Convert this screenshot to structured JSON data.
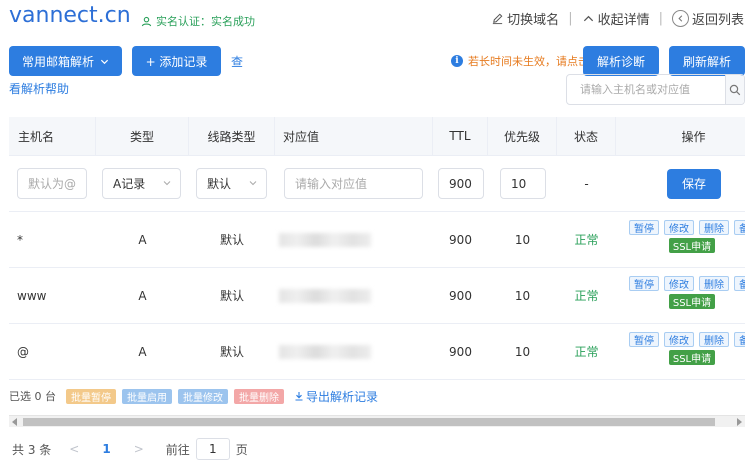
{
  "header": {
    "domain": "vannect.cn",
    "verify_text": "实名认证：实名成功",
    "switch_label": "切换域名",
    "collapse_label": "收起详情",
    "back_label": "返回列表"
  },
  "toolbar": {
    "mail_resolve_label": "常用邮箱解析",
    "add_record_label": "+ 添加记录",
    "lookup_part1": "查",
    "lookup_part2": "看解析帮助",
    "notice": "若长时间未生效，请点击:",
    "diagnose_label": "解析诊断",
    "refresh_label": "刷新解析",
    "search_placeholder": "请输入主机名或对应值"
  },
  "table": {
    "headers": [
      "主机名",
      "类型",
      "线路类型",
      "对应值",
      "TTL",
      "优先级",
      "状态",
      "操作"
    ],
    "edit_row": {
      "host_placeholder": "默认为@",
      "type_value": "A记录",
      "line_value": "默认",
      "value_placeholder": "请输入对应值",
      "ttl_value": "900",
      "priority_value": "10",
      "status": "-",
      "save_label": "保存"
    },
    "rows": [
      {
        "host": "*",
        "type": "A",
        "line": "默认",
        "ttl": "900",
        "priority": "10",
        "status": "正常"
      },
      {
        "host": "www",
        "type": "A",
        "line": "默认",
        "ttl": "900",
        "priority": "10",
        "status": "正常"
      },
      {
        "host": "@",
        "type": "A",
        "line": "默认",
        "ttl": "900",
        "priority": "10",
        "status": "正常"
      }
    ],
    "row_actions": {
      "pause": "暂停",
      "edit": "修改",
      "delete": "删除",
      "note": "备注",
      "ssl": "SSL申请"
    }
  },
  "batch": {
    "selected": "已选 0 台",
    "pause": "批量暂停",
    "enable": "批量启用",
    "edit": "批量修改",
    "delete": "批量删除",
    "export": "导出解析记录"
  },
  "pagination": {
    "total": "共 3 条",
    "prev": "<",
    "current_page": "1",
    "next": ">",
    "goto_label": "前往",
    "goto_value": "1",
    "page_suffix": "页"
  },
  "colors": {
    "primary": "#2d7de0",
    "success": "#2aa05a",
    "warning": "#e67a1e"
  }
}
